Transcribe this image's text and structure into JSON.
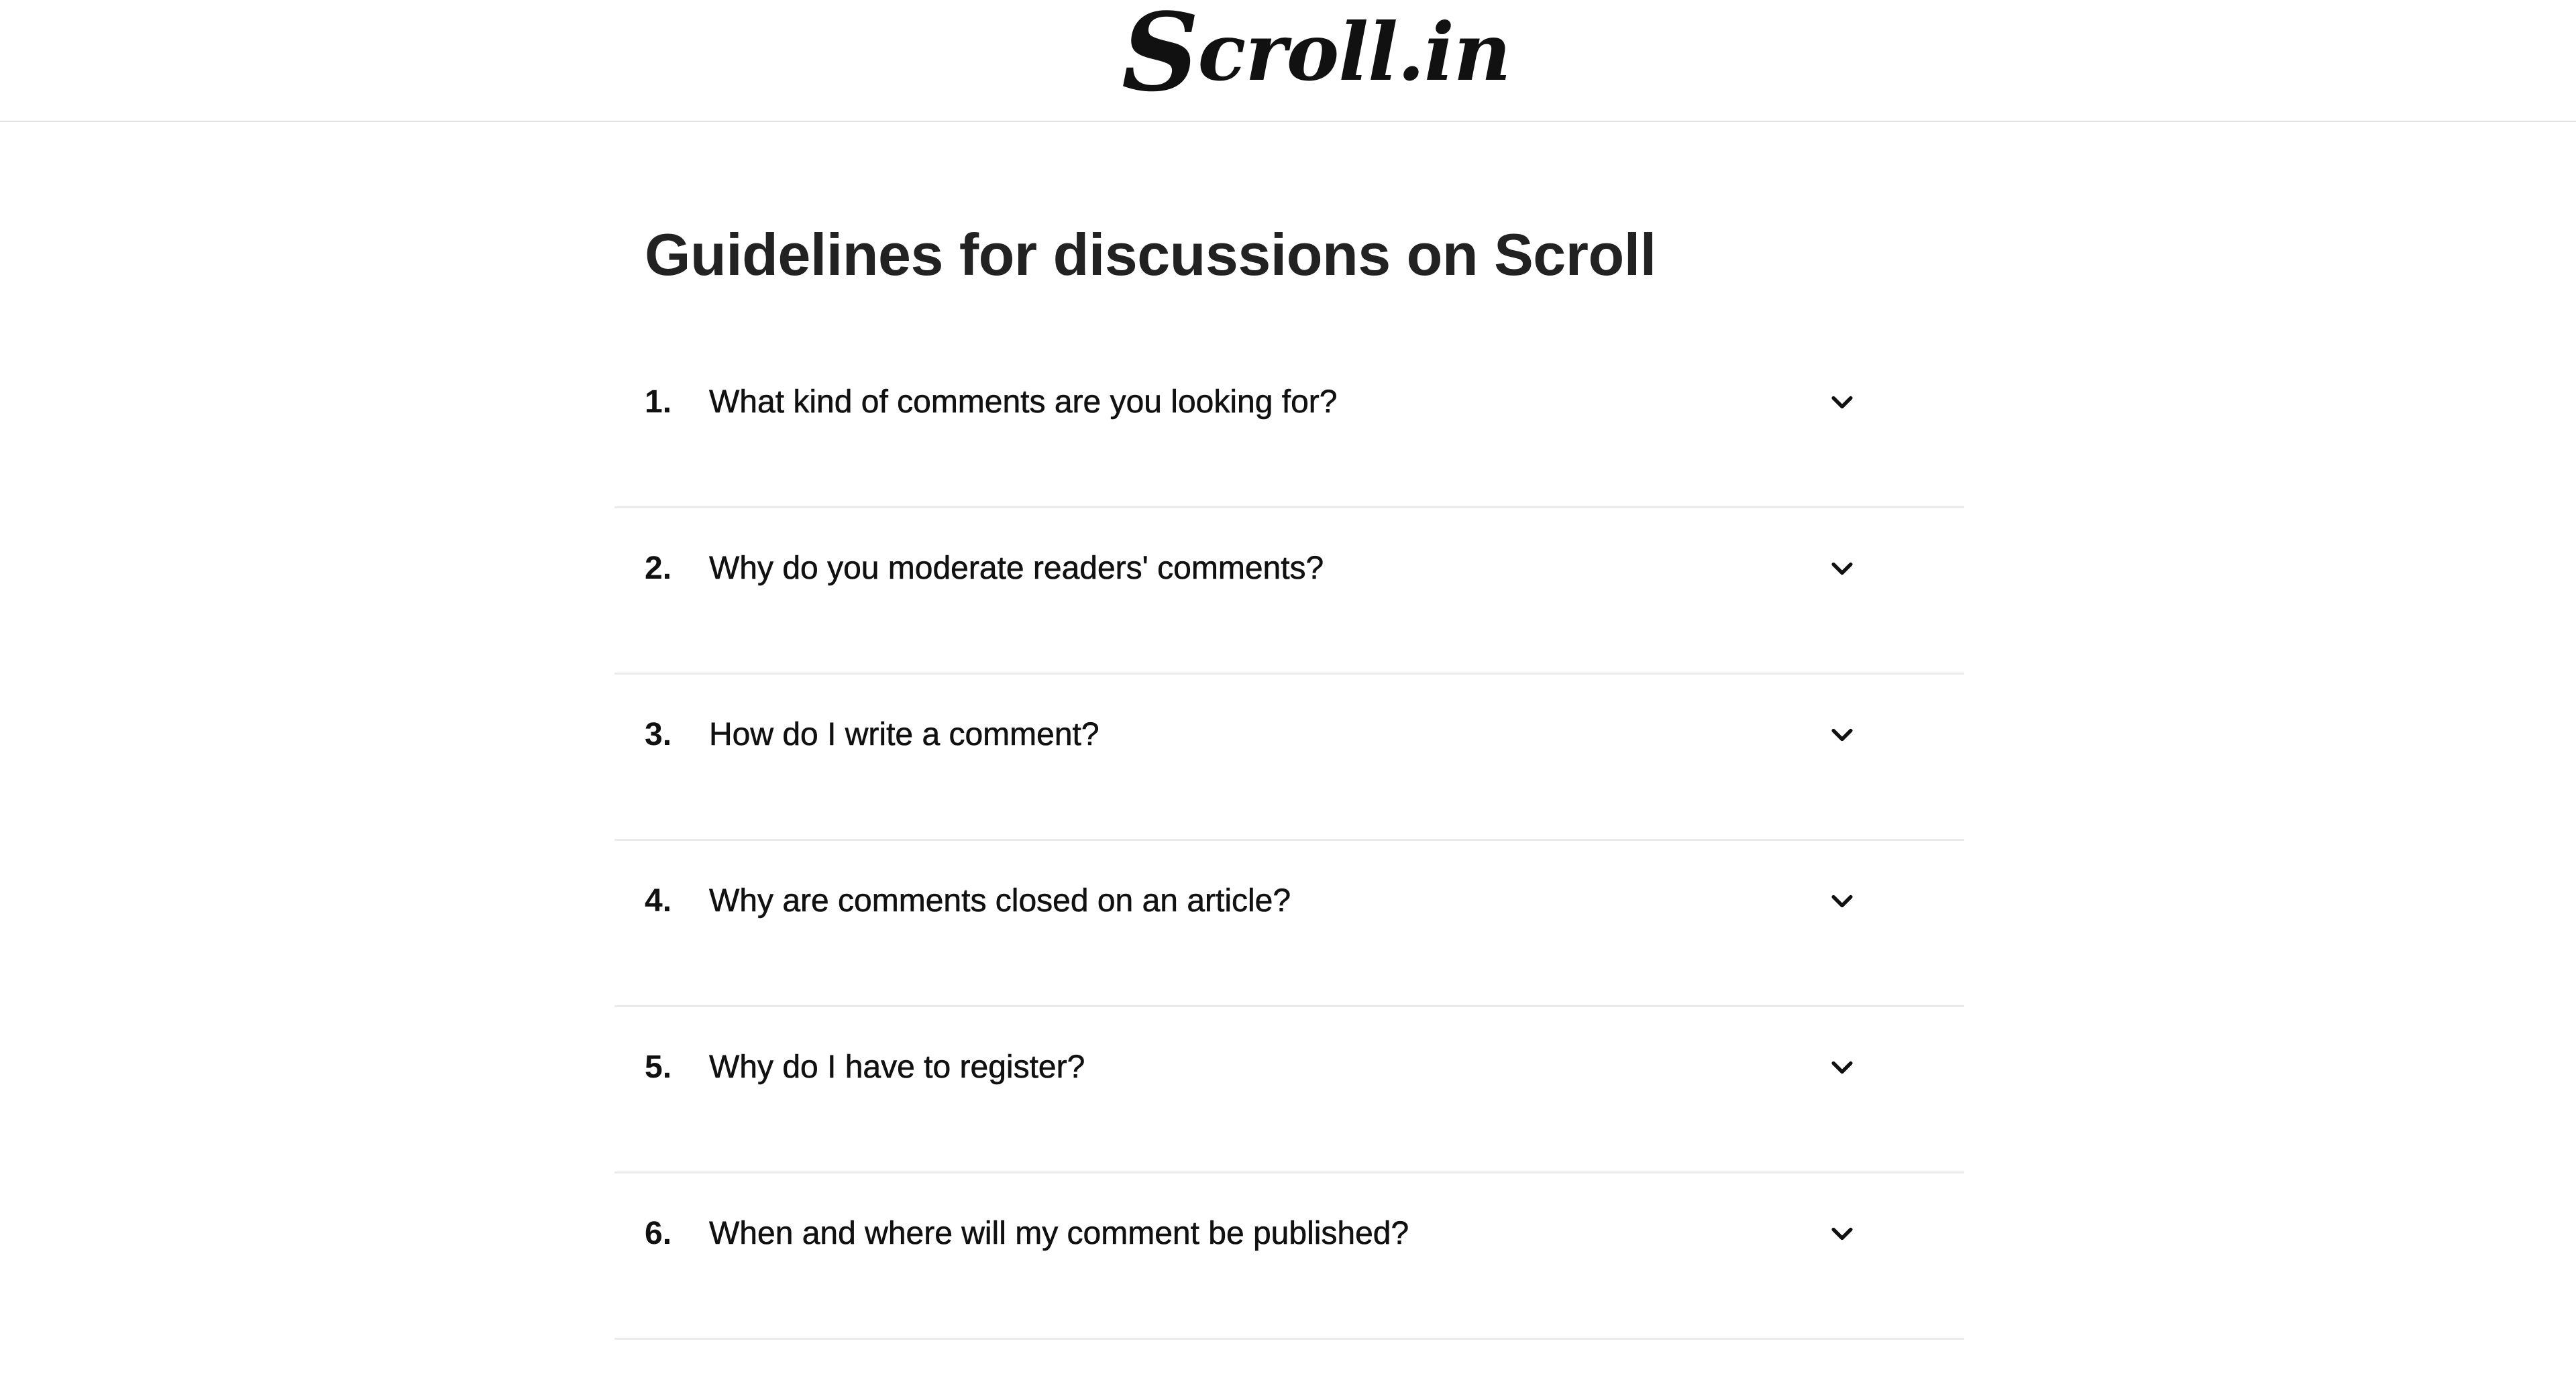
{
  "header": {
    "logo_initial": "S",
    "logo_rest": "croll.in"
  },
  "main": {
    "title": "Guidelines for discussions on Scroll",
    "faqs": [
      {
        "number": "1.",
        "question": "What kind of comments are you looking for?",
        "icon": "chevron-down-icon"
      },
      {
        "number": "2.",
        "question": "Why do you moderate readers' comments?",
        "icon": "chevron-down-icon"
      },
      {
        "number": "3.",
        "question": "How do I write a comment?",
        "icon": "chevron-down-icon"
      },
      {
        "number": "4.",
        "question": "Why are comments closed on an article?",
        "icon": "chevron-down-icon"
      },
      {
        "number": "5.",
        "question": "Why do I have to register?",
        "icon": "chevron-down-icon"
      },
      {
        "number": "6.",
        "question": "When and where will my comment be published?",
        "icon": "chevron-down-icon"
      }
    ]
  },
  "colors": {
    "background": "#ffffff",
    "text": "#111111",
    "divider": "#ebebeb"
  }
}
